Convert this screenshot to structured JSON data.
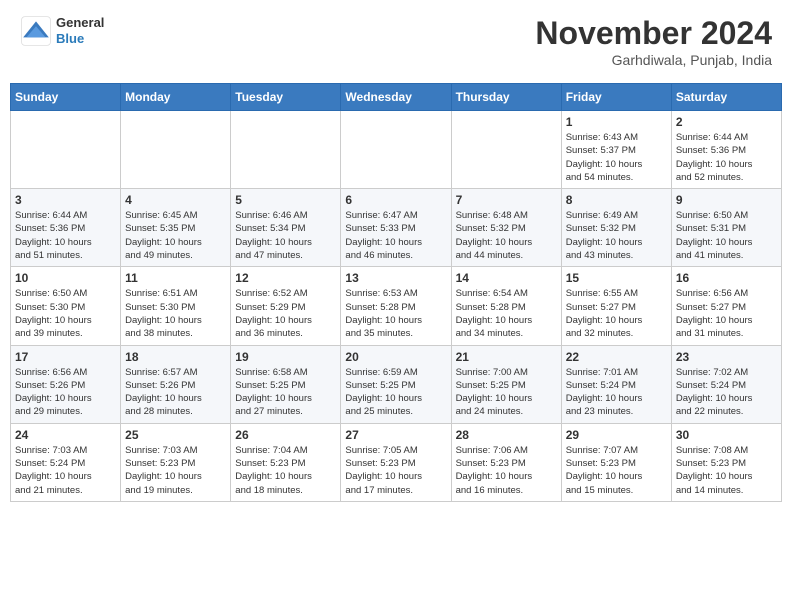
{
  "header": {
    "logo": {
      "general": "General",
      "blue": "Blue"
    },
    "month": "November 2024",
    "location": "Garhdiwala, Punjab, India"
  },
  "weekdays": [
    "Sunday",
    "Monday",
    "Tuesday",
    "Wednesday",
    "Thursday",
    "Friday",
    "Saturday"
  ],
  "weeks": [
    [
      {
        "day": "",
        "info": ""
      },
      {
        "day": "",
        "info": ""
      },
      {
        "day": "",
        "info": ""
      },
      {
        "day": "",
        "info": ""
      },
      {
        "day": "",
        "info": ""
      },
      {
        "day": "1",
        "info": "Sunrise: 6:43 AM\nSunset: 5:37 PM\nDaylight: 10 hours\nand 54 minutes."
      },
      {
        "day": "2",
        "info": "Sunrise: 6:44 AM\nSunset: 5:36 PM\nDaylight: 10 hours\nand 52 minutes."
      }
    ],
    [
      {
        "day": "3",
        "info": "Sunrise: 6:44 AM\nSunset: 5:36 PM\nDaylight: 10 hours\nand 51 minutes."
      },
      {
        "day": "4",
        "info": "Sunrise: 6:45 AM\nSunset: 5:35 PM\nDaylight: 10 hours\nand 49 minutes."
      },
      {
        "day": "5",
        "info": "Sunrise: 6:46 AM\nSunset: 5:34 PM\nDaylight: 10 hours\nand 47 minutes."
      },
      {
        "day": "6",
        "info": "Sunrise: 6:47 AM\nSunset: 5:33 PM\nDaylight: 10 hours\nand 46 minutes."
      },
      {
        "day": "7",
        "info": "Sunrise: 6:48 AM\nSunset: 5:32 PM\nDaylight: 10 hours\nand 44 minutes."
      },
      {
        "day": "8",
        "info": "Sunrise: 6:49 AM\nSunset: 5:32 PM\nDaylight: 10 hours\nand 43 minutes."
      },
      {
        "day": "9",
        "info": "Sunrise: 6:50 AM\nSunset: 5:31 PM\nDaylight: 10 hours\nand 41 minutes."
      }
    ],
    [
      {
        "day": "10",
        "info": "Sunrise: 6:50 AM\nSunset: 5:30 PM\nDaylight: 10 hours\nand 39 minutes."
      },
      {
        "day": "11",
        "info": "Sunrise: 6:51 AM\nSunset: 5:30 PM\nDaylight: 10 hours\nand 38 minutes."
      },
      {
        "day": "12",
        "info": "Sunrise: 6:52 AM\nSunset: 5:29 PM\nDaylight: 10 hours\nand 36 minutes."
      },
      {
        "day": "13",
        "info": "Sunrise: 6:53 AM\nSunset: 5:28 PM\nDaylight: 10 hours\nand 35 minutes."
      },
      {
        "day": "14",
        "info": "Sunrise: 6:54 AM\nSunset: 5:28 PM\nDaylight: 10 hours\nand 34 minutes."
      },
      {
        "day": "15",
        "info": "Sunrise: 6:55 AM\nSunset: 5:27 PM\nDaylight: 10 hours\nand 32 minutes."
      },
      {
        "day": "16",
        "info": "Sunrise: 6:56 AM\nSunset: 5:27 PM\nDaylight: 10 hours\nand 31 minutes."
      }
    ],
    [
      {
        "day": "17",
        "info": "Sunrise: 6:56 AM\nSunset: 5:26 PM\nDaylight: 10 hours\nand 29 minutes."
      },
      {
        "day": "18",
        "info": "Sunrise: 6:57 AM\nSunset: 5:26 PM\nDaylight: 10 hours\nand 28 minutes."
      },
      {
        "day": "19",
        "info": "Sunrise: 6:58 AM\nSunset: 5:25 PM\nDaylight: 10 hours\nand 27 minutes."
      },
      {
        "day": "20",
        "info": "Sunrise: 6:59 AM\nSunset: 5:25 PM\nDaylight: 10 hours\nand 25 minutes."
      },
      {
        "day": "21",
        "info": "Sunrise: 7:00 AM\nSunset: 5:25 PM\nDaylight: 10 hours\nand 24 minutes."
      },
      {
        "day": "22",
        "info": "Sunrise: 7:01 AM\nSunset: 5:24 PM\nDaylight: 10 hours\nand 23 minutes."
      },
      {
        "day": "23",
        "info": "Sunrise: 7:02 AM\nSunset: 5:24 PM\nDaylight: 10 hours\nand 22 minutes."
      }
    ],
    [
      {
        "day": "24",
        "info": "Sunrise: 7:03 AM\nSunset: 5:24 PM\nDaylight: 10 hours\nand 21 minutes."
      },
      {
        "day": "25",
        "info": "Sunrise: 7:03 AM\nSunset: 5:23 PM\nDaylight: 10 hours\nand 19 minutes."
      },
      {
        "day": "26",
        "info": "Sunrise: 7:04 AM\nSunset: 5:23 PM\nDaylight: 10 hours\nand 18 minutes."
      },
      {
        "day": "27",
        "info": "Sunrise: 7:05 AM\nSunset: 5:23 PM\nDaylight: 10 hours\nand 17 minutes."
      },
      {
        "day": "28",
        "info": "Sunrise: 7:06 AM\nSunset: 5:23 PM\nDaylight: 10 hours\nand 16 minutes."
      },
      {
        "day": "29",
        "info": "Sunrise: 7:07 AM\nSunset: 5:23 PM\nDaylight: 10 hours\nand 15 minutes."
      },
      {
        "day": "30",
        "info": "Sunrise: 7:08 AM\nSunset: 5:23 PM\nDaylight: 10 hours\nand 14 minutes."
      }
    ]
  ]
}
